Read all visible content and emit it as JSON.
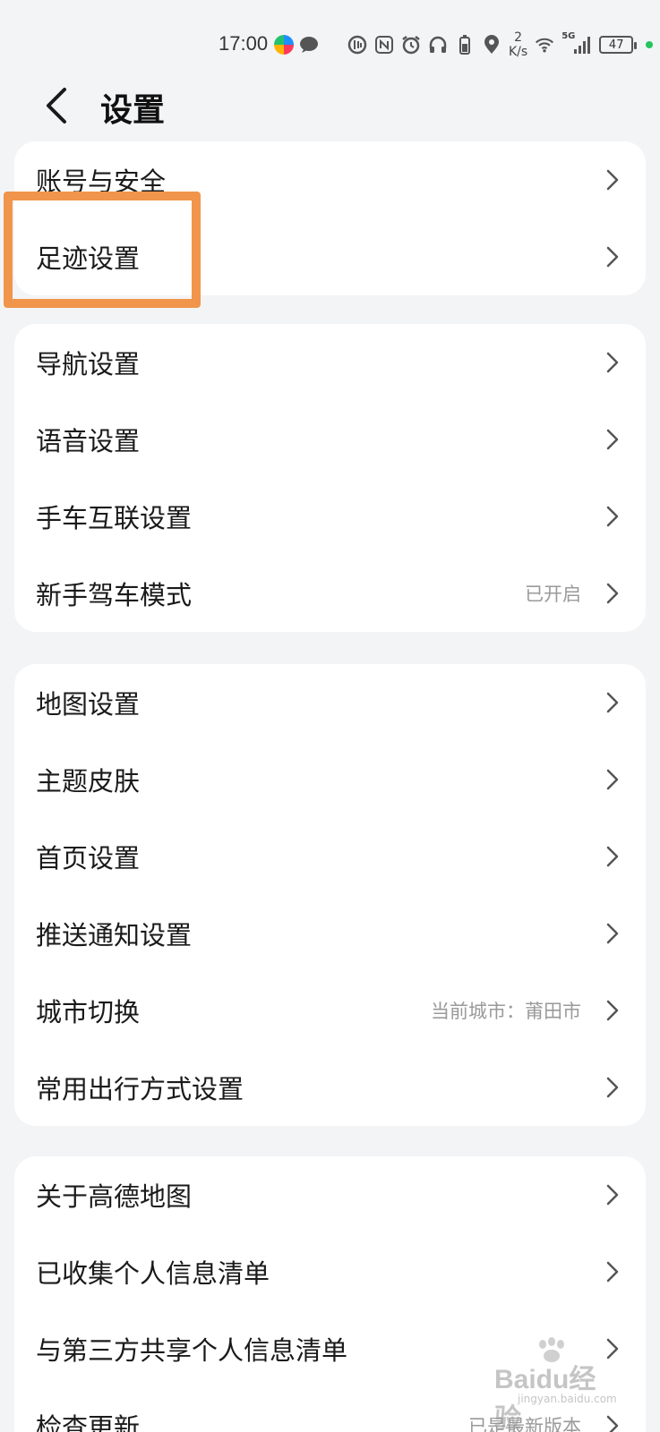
{
  "status_bar": {
    "time": "17:00",
    "net_speed_value": "2",
    "net_speed_unit": "K/s",
    "signal": "5G",
    "battery": "47"
  },
  "header": {
    "title": "设置"
  },
  "sections": [
    {
      "items": [
        {
          "label": "账号与安全",
          "value": ""
        },
        {
          "label": "足迹设置",
          "value": ""
        }
      ]
    },
    {
      "items": [
        {
          "label": "导航设置",
          "value": ""
        },
        {
          "label": "语音设置",
          "value": ""
        },
        {
          "label": "手车互联设置",
          "value": ""
        },
        {
          "label": "新手驾车模式",
          "value": "已开启"
        }
      ]
    },
    {
      "items": [
        {
          "label": "地图设置",
          "value": ""
        },
        {
          "label": "主题皮肤",
          "value": ""
        },
        {
          "label": "首页设置",
          "value": ""
        },
        {
          "label": "推送通知设置",
          "value": ""
        },
        {
          "label": "城市切换",
          "value": "当前城市：莆田市"
        },
        {
          "label": "常用出行方式设置",
          "value": ""
        }
      ]
    },
    {
      "items": [
        {
          "label": "关于高德地图",
          "value": ""
        },
        {
          "label": "已收集个人信息清单",
          "value": ""
        },
        {
          "label": "与第三方共享个人信息清单",
          "value": ""
        },
        {
          "label": "检查更新",
          "value": "已是最新版本"
        }
      ]
    }
  ],
  "watermark": {
    "text": "Baidu经验",
    "sub": "jingyan.baidu.com"
  },
  "colors": {
    "highlight": "#f0954b",
    "background": "#f3f4f6",
    "card": "#ffffff"
  }
}
